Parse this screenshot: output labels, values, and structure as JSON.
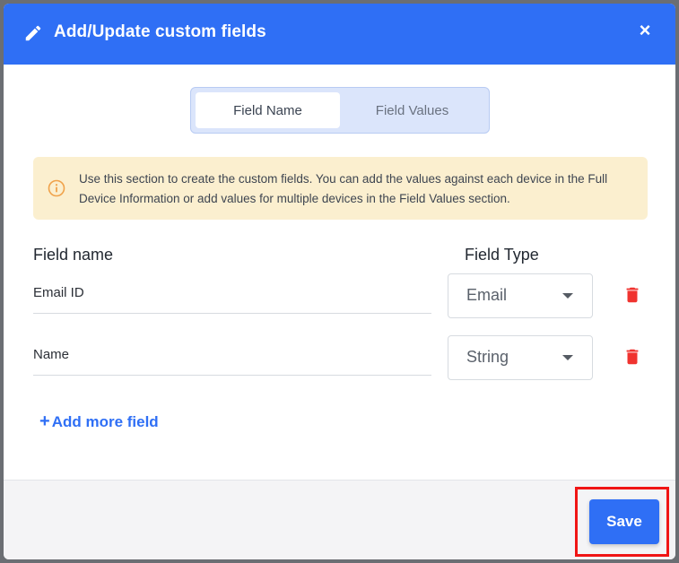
{
  "dialog": {
    "title": "Add/Update custom fields",
    "close_symbol": "×"
  },
  "tabs": [
    {
      "label": "Field Name",
      "active": true
    },
    {
      "label": "Field Values",
      "active": false
    }
  ],
  "info": {
    "icon": "info-circle-icon",
    "text": "Use this section to create the custom fields. You can add the values against each device in the Full Device Information or add values for multiple devices in the Field Values section."
  },
  "columns": {
    "field_name": "Field name",
    "field_type": "Field Type"
  },
  "fields": [
    {
      "name": "Email ID",
      "type": "Email"
    },
    {
      "name": "Name",
      "type": "String"
    }
  ],
  "add_more": {
    "plus": "+",
    "label": "Add more field"
  },
  "footer": {
    "save_label": "Save"
  },
  "colors": {
    "primary": "#2f6ff5",
    "info_bg": "#fbefcf",
    "info_icon": "#f0a24a",
    "delete": "#f0332f",
    "highlight": "#f01515"
  }
}
